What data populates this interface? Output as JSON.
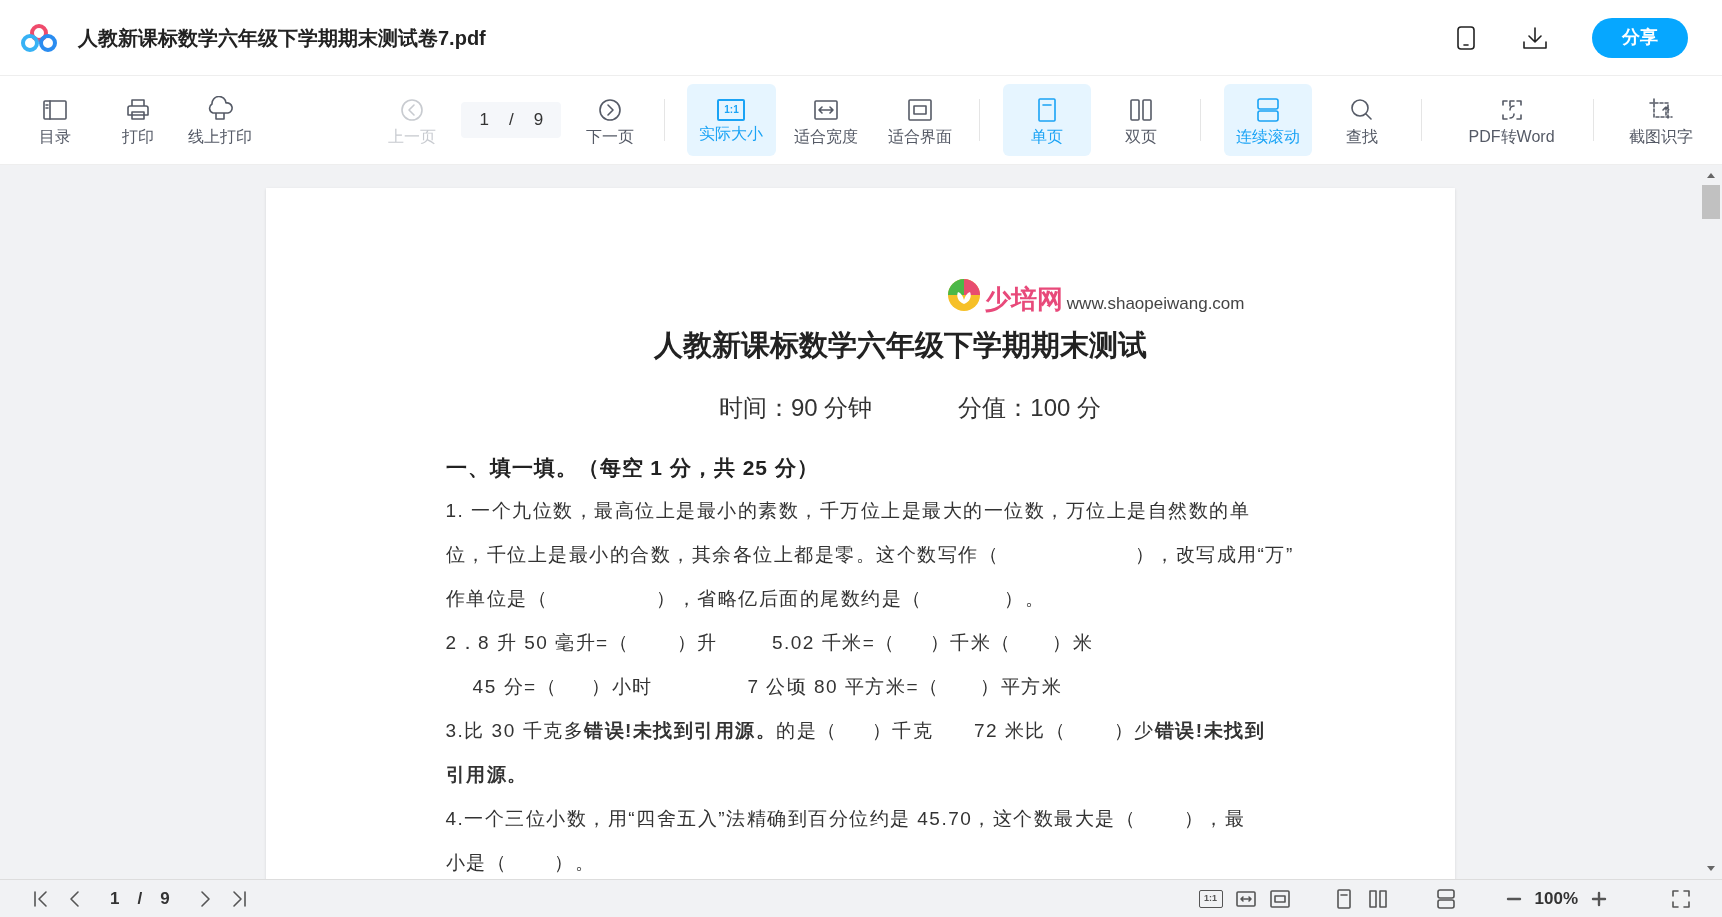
{
  "header": {
    "title": "人教新课标数学六年级下学期期末测试卷7.pdf",
    "share_button": "分享"
  },
  "toolbar": {
    "groups": [
      [
        {
          "kind": "button",
          "label": "目录",
          "selected": false,
          "disabled": false
        },
        {
          "kind": "button",
          "label": "打印",
          "selected": false,
          "disabled": false
        },
        {
          "kind": "button",
          "label": "线上打印",
          "selected": false,
          "disabled": false
        }
      ],
      [
        {
          "kind": "button",
          "label": "上一页",
          "selected": false,
          "disabled": true
        },
        {
          "kind": "pager",
          "current": "1",
          "separator": "/",
          "total": "9"
        },
        {
          "kind": "button",
          "label": "下一页",
          "selected": false,
          "disabled": false
        }
      ],
      [
        {
          "kind": "button",
          "label": "实际大小",
          "icon_text": "1:1",
          "selected": true,
          "disabled": false
        },
        {
          "kind": "button",
          "label": "适合宽度",
          "selected": false,
          "disabled": false
        },
        {
          "kind": "button",
          "label": "适合界面",
          "selected": false,
          "disabled": false
        }
      ],
      [
        {
          "kind": "button",
          "label": "单页",
          "selected": true,
          "disabled": false
        },
        {
          "kind": "button",
          "label": "双页",
          "selected": false,
          "disabled": false
        }
      ],
      [
        {
          "kind": "button",
          "label": "连续滚动",
          "selected": true,
          "disabled": false
        },
        {
          "kind": "button",
          "label": "查找",
          "selected": false,
          "disabled": false
        }
      ],
      [
        {
          "kind": "button",
          "label": "PDF转Word",
          "selected": false,
          "disabled": false
        }
      ],
      [
        {
          "kind": "button",
          "label": "截图识字",
          "selected": false,
          "disabled": false
        }
      ]
    ]
  },
  "document": {
    "logo_text": "少培网",
    "logo_url": "www.shaopeiwang.com",
    "title": "人教新课标数学六年级下学期期末测试",
    "meta": [
      "时间：90 分钟",
      "分值：100 分"
    ],
    "lines": [
      {
        "text": "一、填一填。（每空 1 分，共 25 分）",
        "bold": true
      },
      {
        "text": "1. 一个九位数，最高位上是最小的素数，千万位上是最大的一位数，万位上是自然数的单",
        "bold": false
      },
      {
        "text": "位，千位上是最小的合数，其余各位上都是零。这个数写作（                    ），改写成用“万”",
        "bold": false
      },
      {
        "text": "作单位是（                ），省略亿后面的尾数约是（            ）。",
        "bold": false
      },
      {
        "text": "2．8 升 50 毫升=（       ）升        5.02 千米=（     ）千米（      ）米",
        "bold": false
      },
      {
        "text": "    45 分=（     ）小时              7 公顷 80 平方米=（      ）平方米",
        "bold": false
      },
      {
        "text": "3.比 30 千克多**错误!未找到引用源。**的是（     ）千克      72 米比（       ）少**错误!未找到**",
        "bold": false
      },
      {
        "text": "引用源。",
        "bold": true
      },
      {
        "text": "4.一个三位小数，用“四舍五入”法精确到百分位约是 45.70，这个数最大是（       ），最",
        "bold": false
      },
      {
        "text": "小是（       ）。",
        "bold": false
      }
    ]
  },
  "bottom_bar": {
    "current": "1",
    "separator": "/",
    "total": "9",
    "fit_actual_icon_text": "1:1",
    "zoom": "100%"
  }
}
